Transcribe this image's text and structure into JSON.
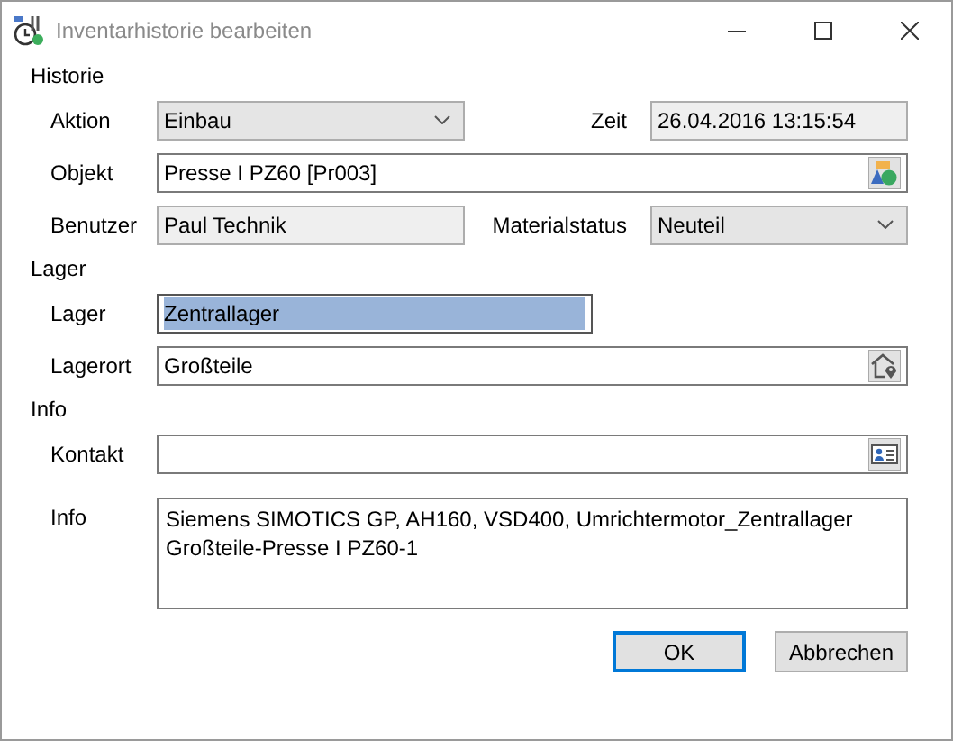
{
  "window": {
    "title": "Inventarhistorie bearbeiten"
  },
  "sections": [
    {
      "heading": "Historie",
      "rows": [
        {
          "fields": [
            {
              "label": "Aktion",
              "value": "Einbau",
              "kind": "select"
            },
            {
              "label": "Zeit",
              "value": "26.04.2016 13:15:54",
              "kind": "readonly"
            }
          ]
        },
        {
          "fields": [
            {
              "label": "Objekt",
              "value": "Presse I PZ60 [Pr003]",
              "kind": "text",
              "picker": {
                "kind": "object"
              }
            }
          ]
        },
        {
          "fields": [
            {
              "label": "Benutzer",
              "value": "Paul Technik",
              "kind": "readonly"
            },
            {
              "label": "Materialstatus",
              "value": "Neuteil",
              "kind": "select"
            }
          ]
        }
      ]
    },
    {
      "heading": "Lager",
      "rows": [
        {
          "fields": [
            {
              "label": "Lager",
              "value": "Zentrallager",
              "kind": "text",
              "text_selected": true
            }
          ]
        },
        {
          "fields": [
            {
              "label": "Lagerort",
              "value": "Großteile",
              "kind": "text",
              "picker": {
                "kind": "location"
              }
            }
          ]
        }
      ]
    },
    {
      "heading": "Info",
      "rows": [
        {
          "fields": [
            {
              "label": "Kontakt",
              "kind": "text",
              "picker": {
                "kind": "contact"
              }
            }
          ]
        },
        {
          "fields": [
            {
              "label": "Info",
              "value": "Siemens SIMOTICS GP, AH160, VSD400, Umrichtermotor_Zentrallager Großteile-Presse I PZ60-1",
              "kind": "textarea"
            }
          ]
        }
      ]
    }
  ],
  "buttons": [
    {
      "label": "OK",
      "default": true
    },
    {
      "label": "Abbrechen",
      "default": false
    }
  ]
}
